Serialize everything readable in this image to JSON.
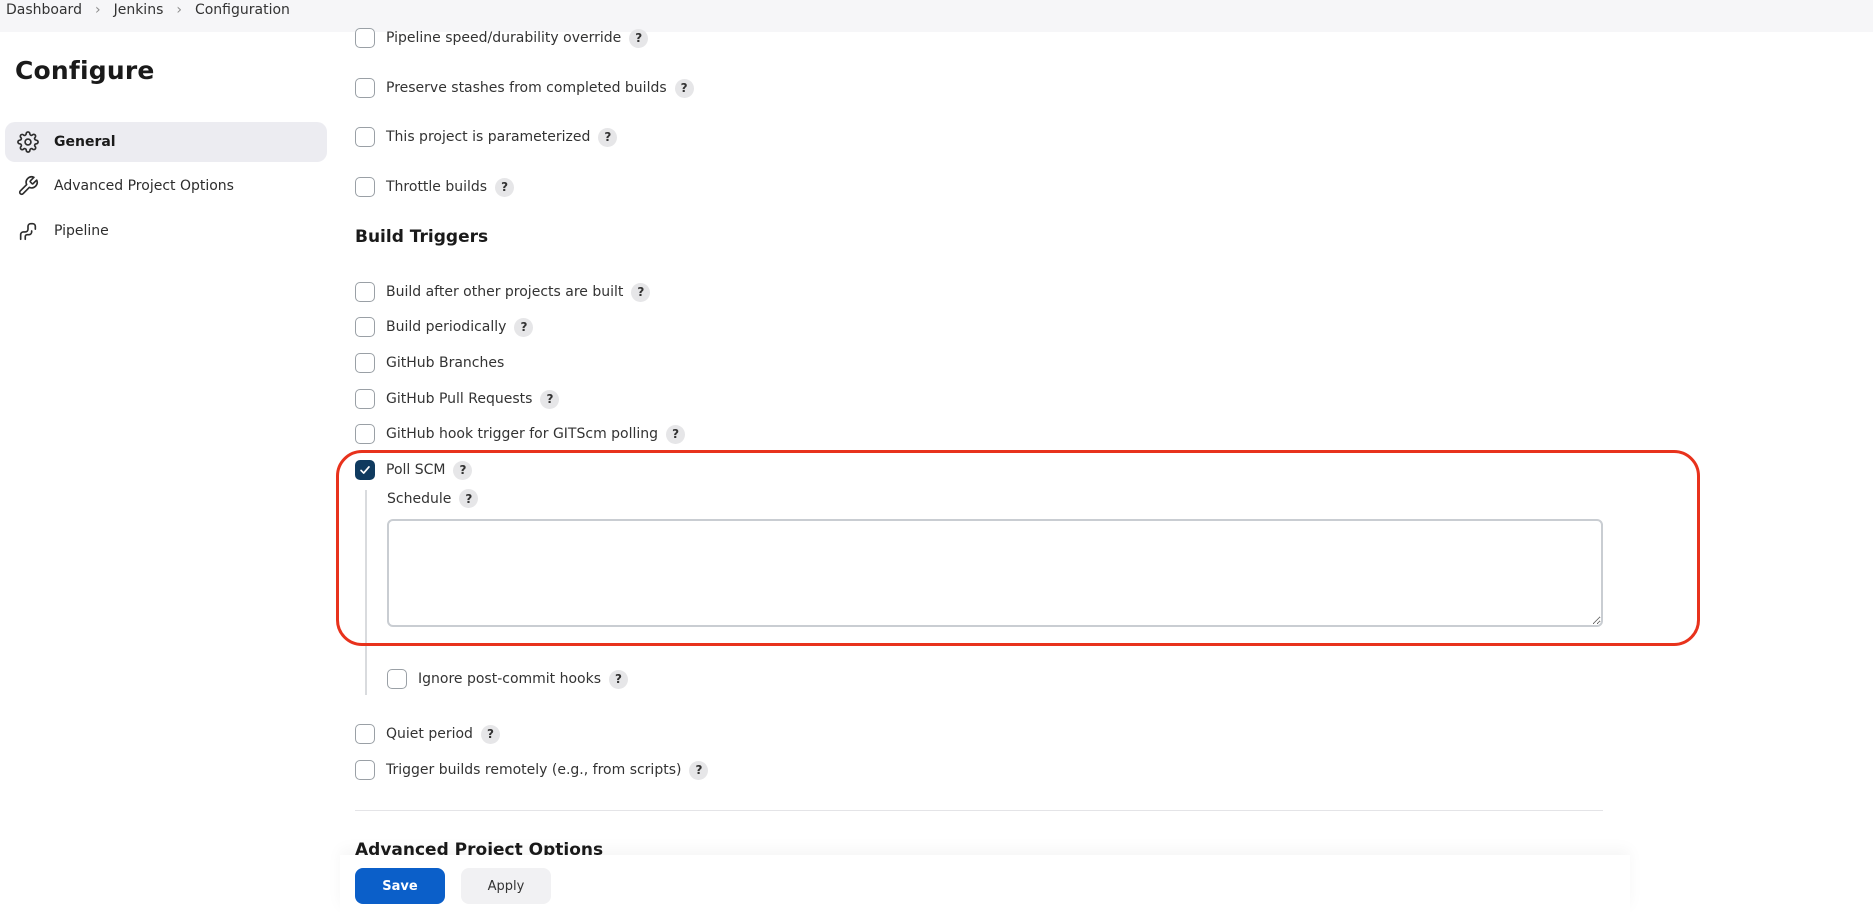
{
  "breadcrumb": {
    "items": [
      "Dashboard",
      "Jenkins",
      "Configuration"
    ]
  },
  "sidebar": {
    "title": "Configure",
    "items": [
      {
        "label": "General",
        "icon": "gear-icon",
        "active": true
      },
      {
        "label": "Advanced Project Options",
        "icon": "wrench-icon",
        "active": false
      },
      {
        "label": "Pipeline",
        "icon": "pipeline-icon",
        "active": false
      }
    ]
  },
  "general": {
    "options": [
      {
        "label": "Pipeline speed/durability override",
        "checked": false
      },
      {
        "label": "Preserve stashes from completed builds",
        "checked": false
      },
      {
        "label": "This project is parameterized",
        "checked": false
      },
      {
        "label": "Throttle builds",
        "checked": false
      }
    ]
  },
  "build_triggers": {
    "title": "Build Triggers",
    "options": [
      {
        "label": "Build after other projects are built",
        "checked": false
      },
      {
        "label": "Build periodically",
        "checked": false
      },
      {
        "label": "GitHub Branches",
        "checked": false
      },
      {
        "label": "GitHub Pull Requests",
        "checked": false
      },
      {
        "label": "GitHub hook trigger for GITScm polling",
        "checked": false
      },
      {
        "label": "Poll SCM",
        "checked": true
      }
    ],
    "poll_scm": {
      "schedule_label": "Schedule",
      "schedule_value": "",
      "ignore_hooks_label": "Ignore post-commit hooks",
      "ignore_hooks_checked": false
    },
    "more_options": [
      {
        "label": "Quiet period",
        "checked": false
      },
      {
        "label": "Trigger builds remotely (e.g., from scripts)",
        "checked": false
      }
    ]
  },
  "next_section_title": "Advanced Project Options",
  "help_glyph": "?",
  "actions": {
    "save_label": "Save",
    "apply_label": "Apply"
  },
  "colors": {
    "accent_blue": "#0b5fc9",
    "checked_box": "#0f3a5f",
    "highlight_red": "#e8321c"
  }
}
